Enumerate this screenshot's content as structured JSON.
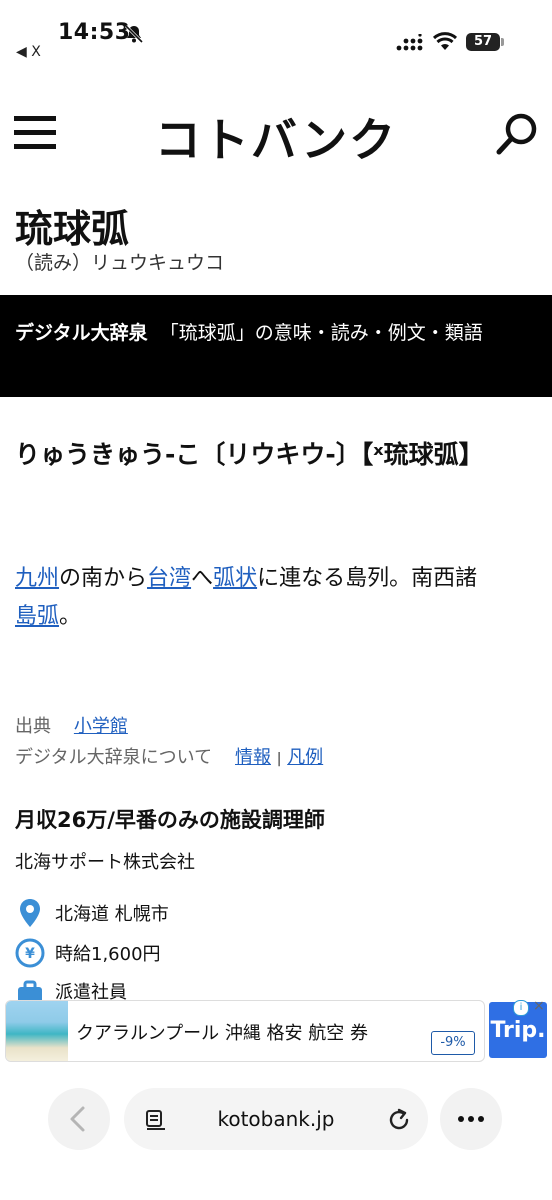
{
  "status_bar": {
    "time": "14:53",
    "back_app": "◀ X",
    "battery": "57"
  },
  "header": {
    "logo": "コトバンク"
  },
  "word": {
    "title": "琉球弧",
    "reading": "（読み）リュウキュウコ"
  },
  "band": {
    "dictionary": "デジタル大辞泉",
    "subtitle": "「琉球弧」の意味・読み・例文・類語"
  },
  "entry": {
    "headword": "りゅうきゅう-こ〔リウキウ-〕【ˣ琉球弧】",
    "definition": {
      "link1": "九州",
      "text1": "の南から",
      "link2": "台湾",
      "text2": "へ",
      "link3": "弧状",
      "text3": "に連なる島列。南西諸",
      "link4": "島弧",
      "text4": "。"
    },
    "source_label": "出典",
    "source_link": "小学館",
    "about_text": "デジタル大辞泉について",
    "about_link1": "情報",
    "about_sep": "|",
    "about_link2": "凡例"
  },
  "job_ad": {
    "title": "月収26万/早番のみの施設調理師",
    "company": "北海サポート株式会社",
    "location": "北海道 札幌市",
    "wage": "時給1,600円",
    "employment": "派遣社員",
    "icons": [
      "location-pin-icon",
      "yen-icon",
      "briefcase-icon"
    ]
  },
  "banner_ad": {
    "text": "クアラルンプール 沖縄 格安 航空 券",
    "discount": "-9%",
    "brand": "Trip.",
    "info": "i",
    "close": "×"
  },
  "bottom_bar": {
    "url": "kotobank.jp"
  },
  "colors": {
    "link": "#1f5fbf",
    "band_bg": "#000000",
    "trip_blue": "#2f6fe4",
    "pin_blue": "#3b8fd6"
  }
}
